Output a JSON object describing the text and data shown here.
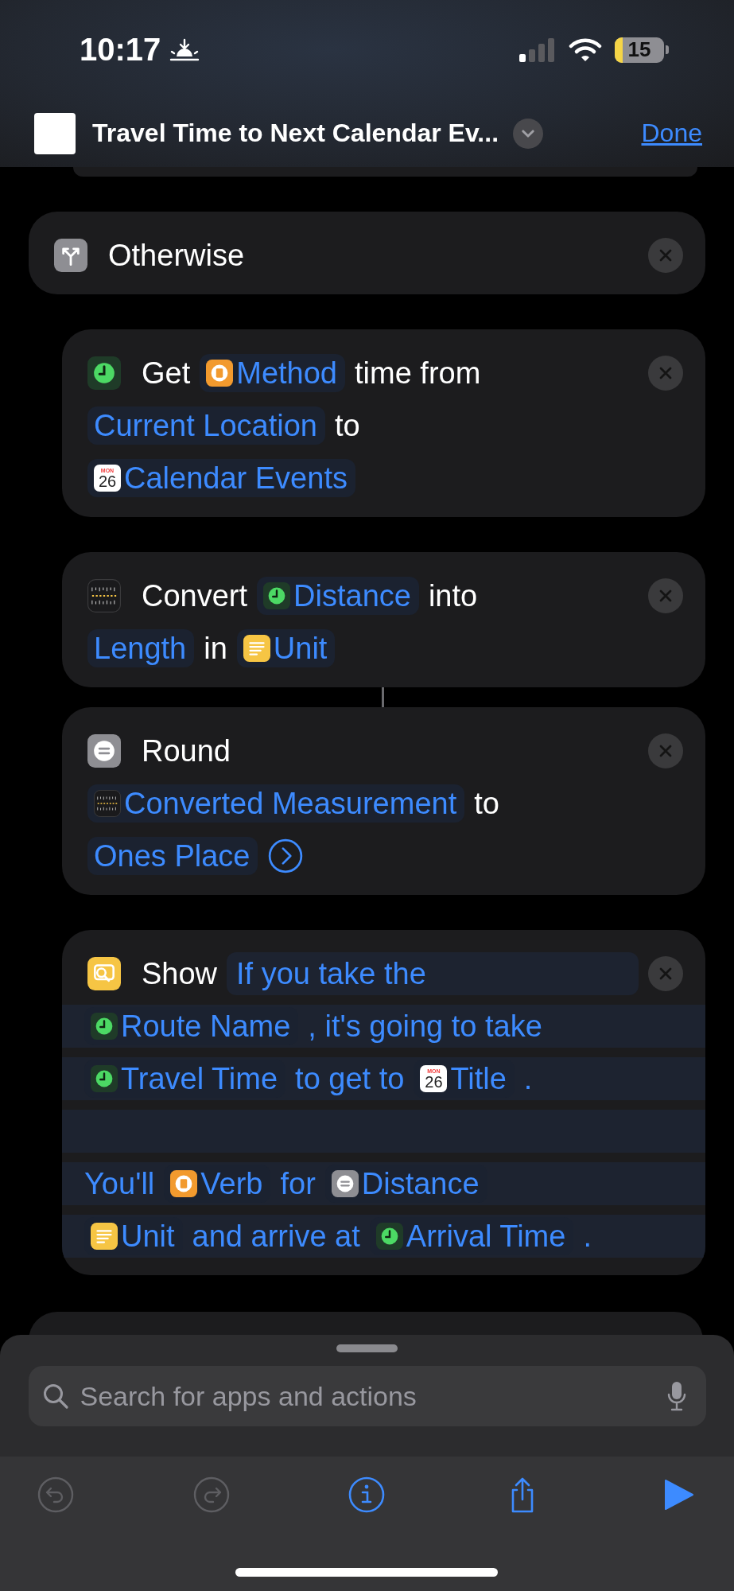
{
  "status_bar": {
    "time": "10:17",
    "battery": "15",
    "low_power": true
  },
  "nav": {
    "title": "Travel Time to Next Calendar Ev...",
    "done": "Done"
  },
  "actions": [
    {
      "kind": "otherwise",
      "removable": true,
      "lines": [
        {
          "tokens": [
            {
              "kind": "word",
              "text": "Otherwise"
            }
          ]
        }
      ],
      "children": [
        {
          "kind": "travel",
          "removable": true,
          "lines": [
            {
              "tokens": [
                {
                  "kind": "word",
                  "text": "Get"
                },
                {
                  "kind": "book_var",
                  "text": "Method"
                },
                {
                  "kind": "word",
                  "text": "time from"
                }
              ]
            },
            {
              "tokens": [
                {
                  "kind": "pill",
                  "text": "Current Location"
                },
                {
                  "kind": "word",
                  "text": "to"
                }
              ]
            },
            {
              "tokens": [
                {
                  "kind": "calendar_var",
                  "day": "MON",
                  "date": "26",
                  "text": "Calendar Events"
                }
              ]
            }
          ]
        },
        {
          "kind": "convert",
          "removable": true,
          "linked_to_next": true,
          "lines": [
            {
              "tokens": [
                {
                  "kind": "word",
                  "text": "Convert"
                },
                {
                  "kind": "clock_var",
                  "text": "Distance"
                },
                {
                  "kind": "word",
                  "text": "into"
                }
              ]
            },
            {
              "tokens": [
                {
                  "kind": "pill",
                  "text": "Length"
                },
                {
                  "kind": "word",
                  "text": "in"
                },
                {
                  "kind": "notes_var",
                  "text": "Unit"
                }
              ]
            }
          ]
        },
        {
          "kind": "round",
          "removable": true,
          "lines": [
            {
              "tokens": [
                {
                  "kind": "word",
                  "text": "Round"
                }
              ]
            },
            {
              "tokens": [
                {
                  "kind": "ruler_var",
                  "text": "Converted Measurement"
                },
                {
                  "kind": "word",
                  "text": "to"
                }
              ]
            },
            {
              "tokens": [
                {
                  "kind": "pill",
                  "text": "Ones Place"
                },
                {
                  "kind": "more"
                }
              ]
            }
          ]
        },
        {
          "kind": "show",
          "removable": true,
          "lines": [
            {
              "tokens": [
                {
                  "kind": "word",
                  "text": "Show"
                },
                {
                  "kind": "text_field",
                  "text": "If you take the"
                }
              ]
            },
            {
              "field": true,
              "tokens": [
                {
                  "kind": "clock_var",
                  "text": "Route Name"
                },
                {
                  "kind": "blue",
                  "text": ", it's going to take"
                }
              ]
            },
            {
              "field": true,
              "tokens": [
                {
                  "kind": "clock_var",
                  "text": "Travel Time"
                },
                {
                  "kind": "blue",
                  "text": "to get to"
                },
                {
                  "kind": "calendar_var",
                  "day": "MON",
                  "date": "26",
                  "text": "Title"
                },
                {
                  "kind": "blue",
                  "text": "."
                }
              ]
            },
            {
              "field": true
            },
            {
              "field": true,
              "tokens": [
                {
                  "kind": "blue",
                  "text": "You'll"
                },
                {
                  "kind": "book_var",
                  "text": "Verb"
                },
                {
                  "kind": "blue",
                  "text": "for"
                },
                {
                  "kind": "equals_var",
                  "text": "Distance"
                }
              ]
            },
            {
              "field": true,
              "tokens": [
                {
                  "kind": "notes_var",
                  "text": "Unit"
                },
                {
                  "kind": "blue",
                  "text": "and arrive at"
                },
                {
                  "kind": "clock_var",
                  "text": "Arrival Time"
                },
                {
                  "kind": "blue",
                  "text": "."
                }
              ]
            }
          ]
        }
      ]
    }
  ],
  "search": {
    "placeholder": "Search for apps and actions"
  },
  "toolbar": [
    {
      "kind": "undo",
      "disabled": true
    },
    {
      "kind": "redo",
      "disabled": true
    },
    {
      "kind": "info",
      "disabled": false
    },
    {
      "kind": "share",
      "disabled": false
    },
    {
      "kind": "play",
      "disabled": false
    }
  ]
}
